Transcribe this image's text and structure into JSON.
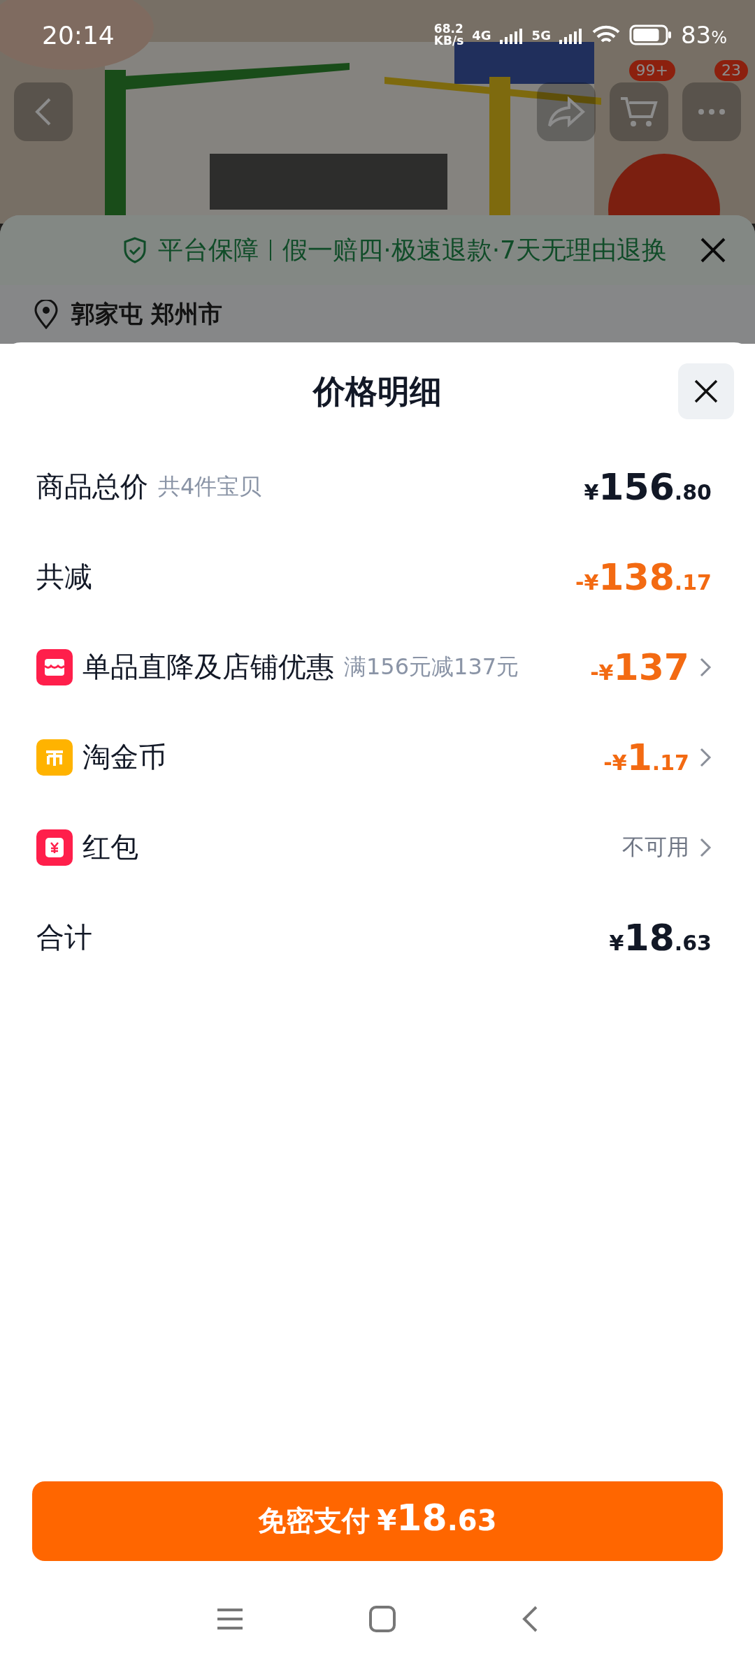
{
  "status_bar": {
    "time": "20:14",
    "net_speed_value": "68.2",
    "net_speed_unit": "KB/s",
    "sim1": "4G",
    "sim2": "5G",
    "battery": "83",
    "battery_unit": "%"
  },
  "product_header": {
    "cart_badge": "99+",
    "more_badge": "23"
  },
  "guarantee": {
    "title": "平台保障",
    "items": "假一赔四·极速退款·7天无理由退换"
  },
  "address": {
    "text": "郭家屯 郑州市"
  },
  "sheet": {
    "title": "价格明细",
    "rows": [
      {
        "kind": "plain",
        "label": "商品总价",
        "note": "共4件宝贝",
        "value": "¥156.80",
        "color": "#121826",
        "chevron": false
      },
      {
        "kind": "plain",
        "label": "共减",
        "value": "-¥138.17",
        "color": "#f36a12",
        "chevron": false
      },
      {
        "kind": "shop",
        "label": "单品直降及店铺优惠",
        "note": "满156元减137元",
        "value": "-¥137",
        "color": "#f36a12",
        "chevron": true
      },
      {
        "kind": "coin",
        "label": "淘金币",
        "value": "-¥1.17",
        "color": "#f36a12",
        "chevron": true
      },
      {
        "kind": "envelope",
        "label": "红包",
        "value": "不可用",
        "color": "#6f7684",
        "chevron": true
      },
      {
        "kind": "plain",
        "label": "合计",
        "value": "¥18.63",
        "color": "#121826",
        "chevron": false
      }
    ],
    "pay_button": {
      "label": "免密支付",
      "value": "¥18.63"
    }
  }
}
